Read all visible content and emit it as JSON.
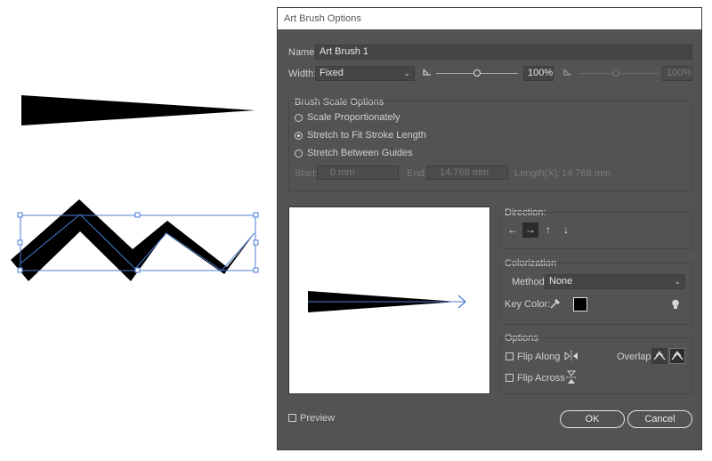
{
  "dialog": {
    "title": "Art Brush Options",
    "name_label": "Name:",
    "name_value": "Art Brush 1",
    "width_label": "Width:",
    "width_value": "Fixed",
    "width_percent": "100%",
    "width_percent_right": "100%",
    "width_slider_level": 0.5,
    "brush_scale": {
      "title": "Brush Scale Options",
      "options": [
        "Scale Proportionately",
        "Stretch to Fit Stroke Length",
        "Stretch Between Guides"
      ],
      "selected_index": 1,
      "start_label": "Start:",
      "start_value": "0 mm",
      "end_label": "End:",
      "end_value": "14.768 mm",
      "length_label": "Length(X):",
      "length_value": "14.768 mm"
    },
    "direction": {
      "title": "Direction:",
      "buttons": [
        "←",
        "→",
        "↑",
        "↓"
      ],
      "selected_index": 1
    },
    "colorization": {
      "title": "Colorization",
      "method_label": "Method:",
      "method_value": "None",
      "key_color_label": "Key Color:",
      "key_color": "#000000"
    },
    "options": {
      "title": "Options",
      "flip_along": "Flip Along",
      "flip_across": "Flip Across",
      "overlap_label": "Overlap:"
    },
    "preview_label": "Preview",
    "ok_label": "OK",
    "cancel_label": "Cancel"
  },
  "colors": {
    "dialog_bg": "#535353",
    "selection_blue": "#4a7bd6",
    "art": "#000000"
  }
}
